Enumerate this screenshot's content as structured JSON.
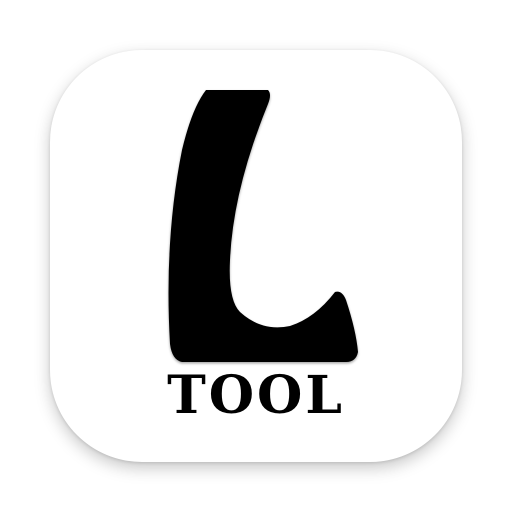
{
  "app_icon": {
    "wordmark": "TOOL",
    "glyph": "L",
    "glyph_icon": "letter-l-icon",
    "colors": {
      "tile": "#ffffff",
      "mark": "#000000"
    }
  }
}
